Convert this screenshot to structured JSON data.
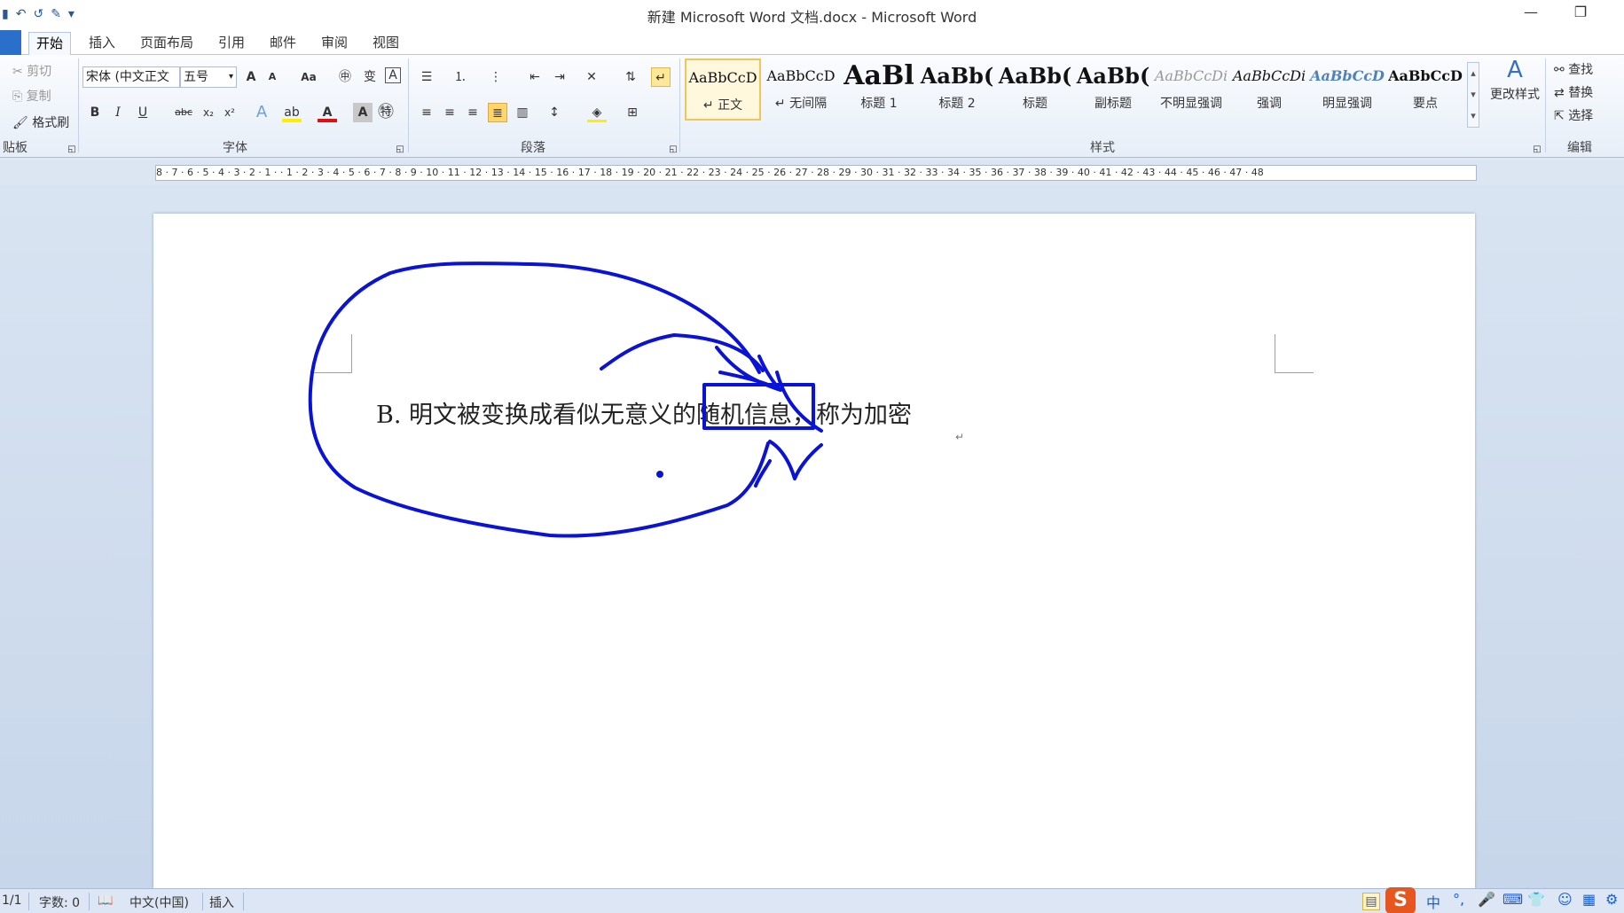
{
  "window": {
    "title": "新建 Microsoft Word 文档.docx - Microsoft Word",
    "minimize_glyph": "—",
    "restore_glyph": "❐"
  },
  "qat": {
    "save_glyph": "▮",
    "undo_glyph": "↶",
    "redo_glyph": "↺",
    "customize_glyph": "▾"
  },
  "tabs": {
    "file_label": "",
    "items": [
      "开始",
      "插入",
      "页面布局",
      "引用",
      "邮件",
      "审阅",
      "视图"
    ]
  },
  "clipboard": {
    "cut": "剪切",
    "copy": "复制",
    "format_painter": "格式刷",
    "label": "贴板"
  },
  "font": {
    "name": "宋体 (中文正文",
    "size": "五号",
    "label": "字体",
    "bold": "B",
    "italic": "I",
    "underline": "U",
    "strike": "abc",
    "subscript": "x₂",
    "superscript": "x²",
    "grow": "A",
    "shrink": "A",
    "change_case": "Aa",
    "clear": "A",
    "font_color": "A",
    "char_shading": "A"
  },
  "paragraph": {
    "label": "段落"
  },
  "styles": {
    "label": "样式",
    "items": [
      {
        "sample": "AaBbCcD",
        "name": "↵ 正文"
      },
      {
        "sample": "AaBbCcD",
        "name": "↵ 无间隔"
      },
      {
        "sample": "AaBl",
        "name": "标题 1"
      },
      {
        "sample": "AaBb(",
        "name": "标题 2"
      },
      {
        "sample": "AaBb(",
        "name": "标题"
      },
      {
        "sample": "AaBb(",
        "name": "副标题"
      },
      {
        "sample": "AaBbCcDi",
        "name": "不明显强调"
      },
      {
        "sample": "AaBbCcDi",
        "name": "强调"
      },
      {
        "sample": "AaBbCcD",
        "name": "明显强调"
      },
      {
        "sample": "AaBbCcD",
        "name": "要点"
      }
    ],
    "change_styles": "更改样式"
  },
  "editing": {
    "find": "查找",
    "replace": "替换",
    "select": "选择",
    "label": "编辑"
  },
  "ruler": {
    "marks": "8 · 7 · 6 · 5 · 4 · 3 · 2 · 1 ·   · 1 · 2 · 3 · 4 · 5 · 6 · 7 · 8 · 9 · 10 · 11 · 12 · 13 · 14 · 15 · 16 · 17 · 18 · 19 · 20 · 21 · 22 · 23 · 24 · 25 · 26 · 27 · 28 · 29 · 30 · 31 · 32 · 33 · 34 · 35 · 36 · 37 · 38 · 39 · 40 · 41 · 42 · 43 · 44 · 45 · 46 · 47 · 48"
  },
  "document": {
    "line": "B.  明文被变换成看似无意义的随机信息，称为加密",
    "para_mark": "↵"
  },
  "annotation": {
    "color": "#0a12d6"
  },
  "status": {
    "page": "1/1",
    "words": "字数: 0",
    "language": "中文(中国)",
    "mode": "插入"
  },
  "ime": {
    "logo": "S",
    "lang": "中",
    "punct": "°,",
    "mic": "🎤",
    "keyboard": "⌨",
    "skin": "👕",
    "tools": "⚙"
  }
}
